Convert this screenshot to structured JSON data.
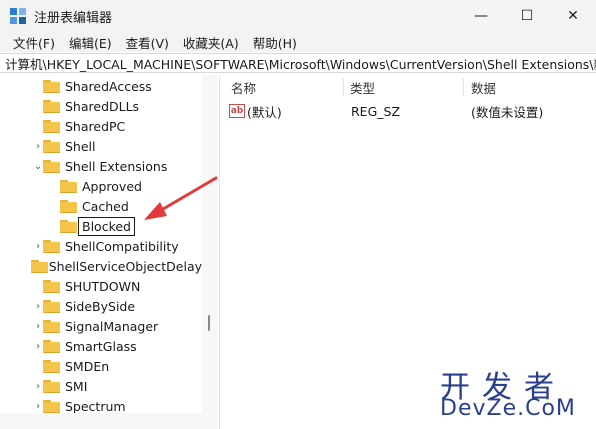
{
  "window": {
    "title": "注册表编辑器",
    "controls": {
      "minimize": "—",
      "maximize": "☐",
      "close": "✕"
    }
  },
  "menu": [
    "文件(F)",
    "编辑(E)",
    "查看(V)",
    "收藏夹(A)",
    "帮助(H)"
  ],
  "address": "计算机\\HKEY_LOCAL_MACHINE\\SOFTWARE\\Microsoft\\Windows\\CurrentVersion\\Shell Extensions\\新项",
  "tree": [
    {
      "label": "SharedAccess",
      "level": 1,
      "chevron": ""
    },
    {
      "label": "SharedDLLs",
      "level": 1,
      "chevron": ""
    },
    {
      "label": "SharedPC",
      "level": 1,
      "chevron": ""
    },
    {
      "label": "Shell",
      "level": 1,
      "chevron": "›"
    },
    {
      "label": "Shell Extensions",
      "level": 1,
      "chevron": "⌄"
    },
    {
      "label": "Approved",
      "level": 2,
      "chevron": ""
    },
    {
      "label": "Cached",
      "level": 2,
      "chevron": ""
    },
    {
      "label": "Blocked",
      "level": 2,
      "chevron": "",
      "editing": true
    },
    {
      "label": "ShellCompatibility",
      "level": 1,
      "chevron": "›"
    },
    {
      "label": "ShellServiceObjectDelay",
      "level": 1,
      "chevron": ""
    },
    {
      "label": "SHUTDOWN",
      "level": 1,
      "chevron": ""
    },
    {
      "label": "SideBySide",
      "level": 1,
      "chevron": "›"
    },
    {
      "label": "SignalManager",
      "level": 1,
      "chevron": "›"
    },
    {
      "label": "SmartGlass",
      "level": 1,
      "chevron": "›"
    },
    {
      "label": "SMDEn",
      "level": 1,
      "chevron": ""
    },
    {
      "label": "SMI",
      "level": 1,
      "chevron": "›"
    },
    {
      "label": "Spectrum",
      "level": 1,
      "chevron": "›"
    }
  ],
  "columns": {
    "name": "名称",
    "type": "类型",
    "data": "数据"
  },
  "values": [
    {
      "icon": "ab",
      "name": "(默认)",
      "type": "REG_SZ",
      "data": "(数值未设置)"
    }
  ],
  "watermark": {
    "top": "开发者",
    "bottom": "DevZe.CoM"
  },
  "colors": {
    "folder": "#f5c54a",
    "arrow": "#e03a3a",
    "watermark": "#2a3f8f"
  }
}
